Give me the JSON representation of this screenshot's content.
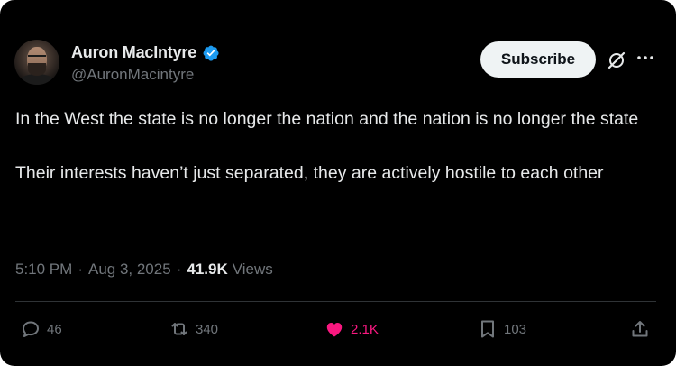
{
  "author": {
    "display_name": "Auron MacIntyre",
    "handle": "@AuronMacintyre",
    "avatar_icon": "profile-photo"
  },
  "header": {
    "subscribe_label": "Subscribe",
    "grok_icon": "grok-icon",
    "more_icon": "more-icon"
  },
  "tweet": {
    "paragraphs": [
      "In the West the state is no longer the nation and the nation is no longer the state",
      "Their interests haven’t just separated, they are actively hostile to each other"
    ],
    "time": "5:10 PM",
    "date": "Aug 3, 2025",
    "separator": "·",
    "views_count": "41.9K",
    "views_label": "Views"
  },
  "actions": {
    "reply": {
      "icon": "reply-icon",
      "count": "46"
    },
    "repost": {
      "icon": "repost-icon",
      "count": "340"
    },
    "like": {
      "icon": "heart-icon",
      "count": "2.1K",
      "liked": true
    },
    "bookmark": {
      "icon": "bookmark-icon",
      "count": "103"
    },
    "share": {
      "icon": "share-icon"
    }
  },
  "colors": {
    "background": "#000000",
    "text": "#e7e9ea",
    "muted": "#71767b",
    "verified": "#1d9bf0",
    "like": "#f91880",
    "subscribe_bg": "#eff3f4"
  }
}
